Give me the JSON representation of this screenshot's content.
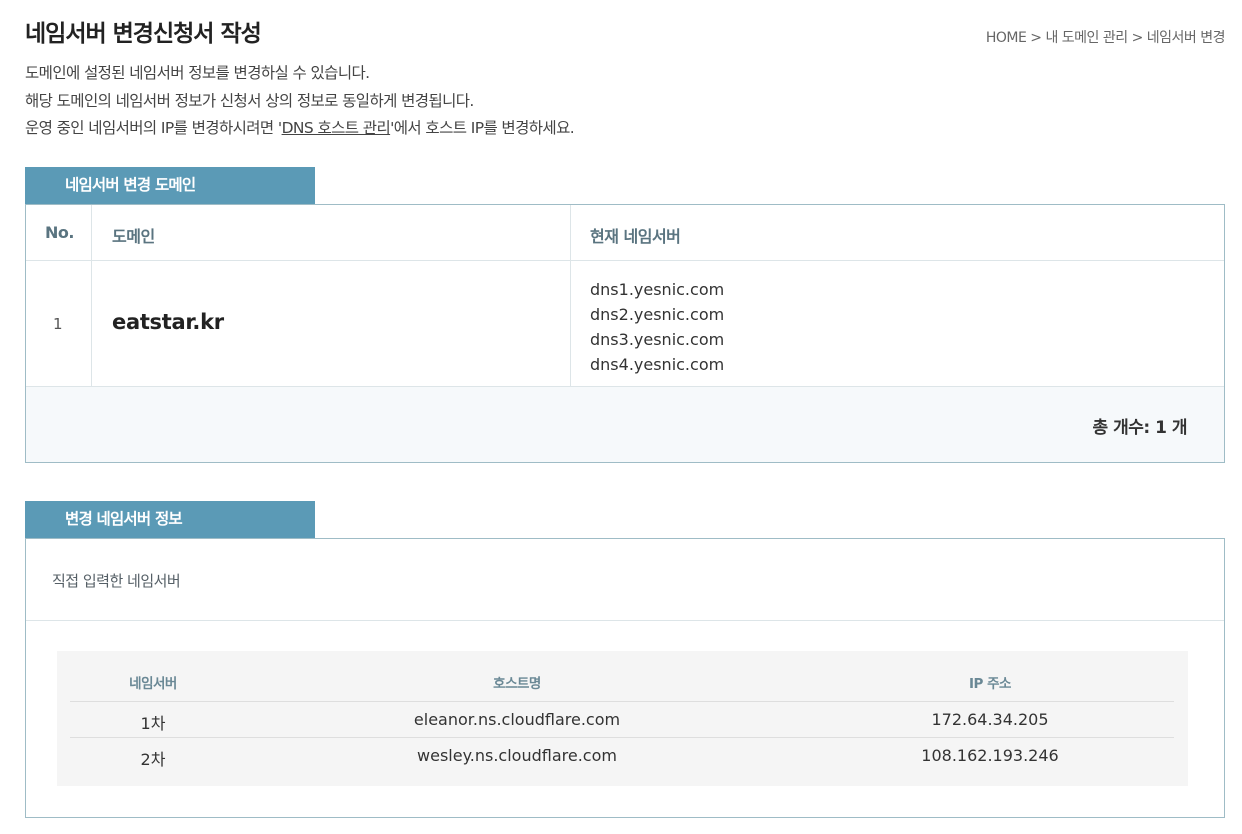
{
  "page": {
    "title": "네임서버 변경신청서 작성",
    "breadcrumb": [
      "HOME",
      "내 도메인 관리",
      "네임서버 변경"
    ],
    "breadcrumb_sep": ">"
  },
  "description": {
    "line1": "도메인에 설정된 네임서버 정보를 변경하실 수 있습니다.",
    "line2": "해당 도메인의 네임서버 정보가 신청서 상의 정보로 동일하게 변경됩니다.",
    "line3_pre": "운영 중인 네임서버의 IP를 변경하시려면 '",
    "line3_link": "DNS 호스트 관리",
    "line3_post": "'에서 호스트 IP를 변경하세요."
  },
  "domain_section": {
    "tab_label": "네임서버 변경 도메인",
    "columns": [
      "No.",
      "도메인",
      "현재 네임서버"
    ],
    "rows": [
      {
        "no": "1",
        "domain": "eatstar.kr",
        "nameservers": [
          "dns1.yesnic.com",
          "dns2.yesnic.com",
          "dns3.yesnic.com",
          "dns4.yesnic.com"
        ]
      }
    ],
    "total_label": "총 개수: 1 개"
  },
  "new_ns_section": {
    "tab_label": "변경 네임서버 정보",
    "sub_label": "직접 입력한 네임서버",
    "columns": [
      "네임서버",
      "호스트명",
      "IP 주소"
    ],
    "rows": [
      {
        "order": "1차",
        "host": "eleanor.ns.cloudflare.com",
        "ip": "172.64.34.205"
      },
      {
        "order": "2차",
        "host": "wesley.ns.cloudflare.com",
        "ip": "108.162.193.246"
      }
    ]
  },
  "colors": {
    "tab_bg": "#5b9ab6",
    "border": "#9fbcc6",
    "header_text": "#5a7480",
    "footer_bg": "#f6f9fb"
  }
}
